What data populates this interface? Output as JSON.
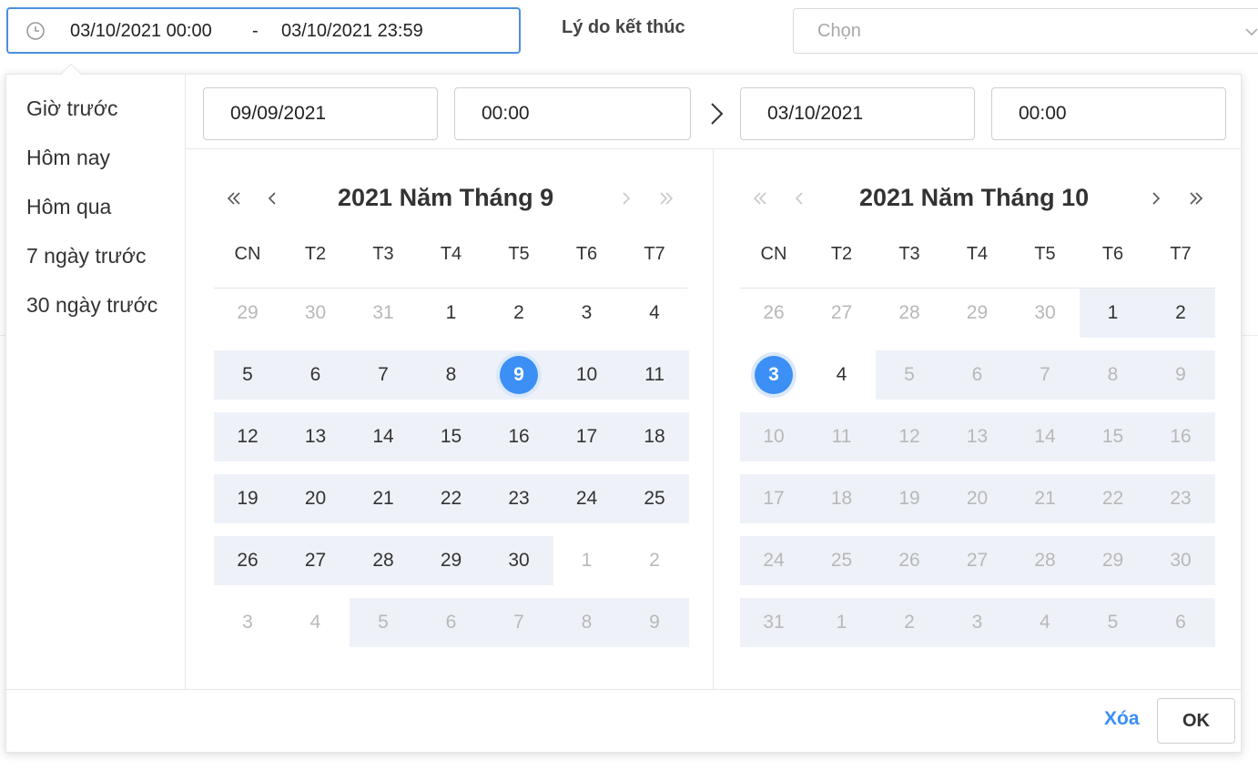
{
  "filter": {
    "range_start": "03/10/2021 00:00",
    "range_separator": "-",
    "range_end": "03/10/2021 23:59",
    "end_reason_label": "Lý do kết thúc",
    "end_reason_placeholder": "Chọn"
  },
  "shortcuts": [
    "Giờ trước",
    "Hôm nay",
    "Hôm qua",
    "7 ngày trước",
    "30 ngày trước"
  ],
  "fields": {
    "start_date": "09/09/2021",
    "start_time": "00:00",
    "end_date": "03/10/2021",
    "end_time": "00:00"
  },
  "weekdays": [
    "CN",
    "T2",
    "T3",
    "T4",
    "T5",
    "T6",
    "T7"
  ],
  "calendars": [
    {
      "title": "2021 Năm Tháng 9",
      "weeks": [
        [
          "29",
          "30",
          "31",
          "1",
          "2",
          "3",
          "4"
        ],
        [
          "5",
          "6",
          "7",
          "8",
          "9",
          "10",
          "11"
        ],
        [
          "12",
          "13",
          "14",
          "15",
          "16",
          "17",
          "18"
        ],
        [
          "19",
          "20",
          "21",
          "22",
          "23",
          "24",
          "25"
        ],
        [
          "26",
          "27",
          "28",
          "29",
          "30",
          "1",
          "2"
        ],
        [
          "3",
          "4",
          "5",
          "6",
          "7",
          "8",
          "9"
        ]
      ]
    },
    {
      "title": "2021 Năm Tháng 10",
      "weeks": [
        [
          "26",
          "27",
          "28",
          "29",
          "30",
          "1",
          "2"
        ],
        [
          "3",
          "4",
          "5",
          "6",
          "7",
          "8",
          "9"
        ],
        [
          "10",
          "11",
          "12",
          "13",
          "14",
          "15",
          "16"
        ],
        [
          "17",
          "18",
          "19",
          "20",
          "21",
          "22",
          "23"
        ],
        [
          "24",
          "25",
          "26",
          "27",
          "28",
          "29",
          "30"
        ],
        [
          "31",
          "1",
          "2",
          "3",
          "4",
          "5",
          "6"
        ]
      ]
    }
  ],
  "footer": {
    "clear_label": "Xóa",
    "ok_label": "OK"
  },
  "colors": {
    "accent": "#3b8ff5",
    "range_bg": "#eef2f8",
    "muted_text": "#b8b8b8"
  }
}
